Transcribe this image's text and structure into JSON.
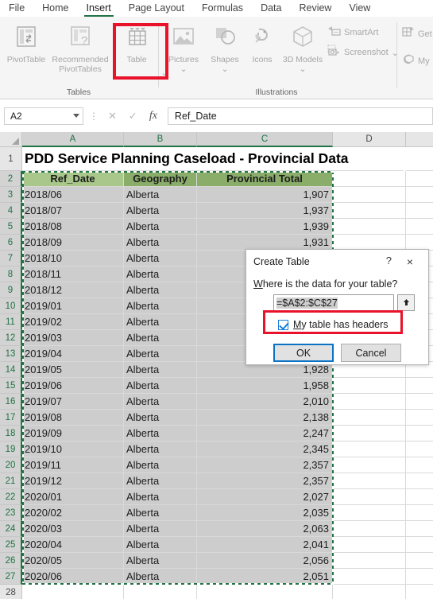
{
  "ribbon": {
    "tabs": [
      {
        "label": "File",
        "active": false
      },
      {
        "label": "Home",
        "active": false
      },
      {
        "label": "Insert",
        "active": true
      },
      {
        "label": "Page Layout",
        "active": false
      },
      {
        "label": "Formulas",
        "active": false
      },
      {
        "label": "Data",
        "active": false
      },
      {
        "label": "Review",
        "active": false
      },
      {
        "label": "View",
        "active": false
      }
    ],
    "groups": [
      {
        "label": "Tables"
      },
      {
        "label": "Illustrations"
      }
    ],
    "buttons": {
      "pivot_table": "PivotTable",
      "recommended_pivot_tables": "Recommended PivotTables",
      "table": "Table",
      "pictures": "Pictures",
      "shapes": "Shapes",
      "icons": "Icons",
      "models_3d": "3D Models",
      "smart_art": "SmartArt",
      "screenshot": "Screenshot",
      "get_addins": "Get",
      "my_addins": "My"
    },
    "highlight_color": "#e8132b",
    "accent_color": "#217346"
  },
  "formula_bar": {
    "name_box": "A2",
    "formula": "Ref_Date",
    "cancel_icon": "cancel-x-icon",
    "confirm_icon": "check-icon",
    "function_icon": "fx"
  },
  "sheet": {
    "columns": [
      {
        "label": "A",
        "selected": true
      },
      {
        "label": "B",
        "selected": true
      },
      {
        "label": "C",
        "selected": true
      },
      {
        "label": "D",
        "selected": false
      }
    ],
    "title_cell": "PDD Service Planning Caseload - Provincial Data",
    "headers": [
      "Ref_Date",
      "Geography",
      "Provincial Total"
    ],
    "rows": [
      {
        "n": 1,
        "type": "title"
      },
      {
        "n": 2,
        "type": "header"
      },
      {
        "n": 3,
        "a": "2018/06",
        "b": "Alberta",
        "c": "1,907"
      },
      {
        "n": 4,
        "a": "2018/07",
        "b": "Alberta",
        "c": "1,937"
      },
      {
        "n": 5,
        "a": "2018/08",
        "b": "Alberta",
        "c": "1,939"
      },
      {
        "n": 6,
        "a": "2018/09",
        "b": "Alberta",
        "c": "1,931"
      },
      {
        "n": 7,
        "a": "2018/10",
        "b": "Alberta",
        "c": ""
      },
      {
        "n": 8,
        "a": "2018/11",
        "b": "Alberta",
        "c": ""
      },
      {
        "n": 9,
        "a": "2018/12",
        "b": "Alberta",
        "c": ""
      },
      {
        "n": 10,
        "a": "2019/01",
        "b": "Alberta",
        "c": ""
      },
      {
        "n": 11,
        "a": "2019/02",
        "b": "Alberta",
        "c": ""
      },
      {
        "n": 12,
        "a": "2019/03",
        "b": "Alberta",
        "c": ""
      },
      {
        "n": 13,
        "a": "2019/04",
        "b": "Alberta",
        "c": ""
      },
      {
        "n": 14,
        "a": "2019/05",
        "b": "Alberta",
        "c": "1,928"
      },
      {
        "n": 15,
        "a": "2019/06",
        "b": "Alberta",
        "c": "1,958"
      },
      {
        "n": 16,
        "a": "2019/07",
        "b": "Alberta",
        "c": "2,010"
      },
      {
        "n": 17,
        "a": "2019/08",
        "b": "Alberta",
        "c": "2,138"
      },
      {
        "n": 18,
        "a": "2019/09",
        "b": "Alberta",
        "c": "2,247"
      },
      {
        "n": 19,
        "a": "2019/10",
        "b": "Alberta",
        "c": "2,345"
      },
      {
        "n": 20,
        "a": "2019/11",
        "b": "Alberta",
        "c": "2,357"
      },
      {
        "n": 21,
        "a": "2019/12",
        "b": "Alberta",
        "c": "2,357"
      },
      {
        "n": 22,
        "a": "2020/01",
        "b": "Alberta",
        "c": "2,027"
      },
      {
        "n": 23,
        "a": "2020/02",
        "b": "Alberta",
        "c": "2,035"
      },
      {
        "n": 24,
        "a": "2020/03",
        "b": "Alberta",
        "c": "2,063"
      },
      {
        "n": 25,
        "a": "2020/04",
        "b": "Alberta",
        "c": "2,041"
      },
      {
        "n": 26,
        "a": "2020/05",
        "b": "Alberta",
        "c": "2,056"
      },
      {
        "n": 27,
        "a": "2020/06",
        "b": "Alberta",
        "c": "2,051"
      },
      {
        "n": 28,
        "a": "",
        "b": "",
        "c": ""
      }
    ],
    "header_fill_active": "#a9c78a",
    "header_fill": "#8aad6a",
    "selection_fill": "#cdcdcd"
  },
  "dialog": {
    "title": "Create Table",
    "help_icon": "?",
    "close_icon": "×",
    "prompt_prefix": "W",
    "prompt_rest": "here is the data for your table?",
    "range_value": "=$A$2:$C$27",
    "collapse_icon": "⬆",
    "checkbox_checked": true,
    "checkbox_accel": "M",
    "checkbox_rest": "y table has headers",
    "ok_label": "OK",
    "cancel_label": "Cancel",
    "focus_color": "#0b72c4",
    "highlight_color": "#e8132b"
  }
}
